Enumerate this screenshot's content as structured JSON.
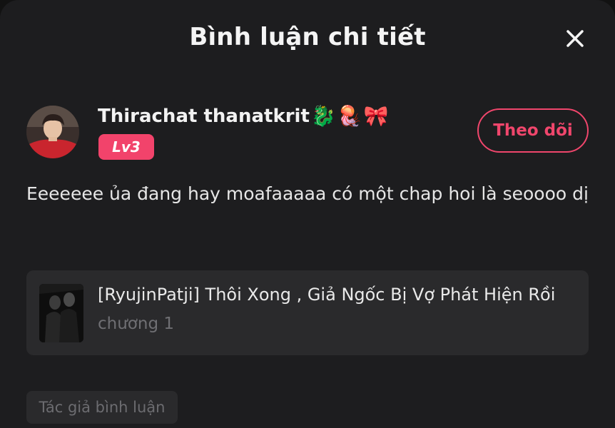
{
  "header": {
    "title": "Bình luận chi tiết",
    "close_icon": "close-icon"
  },
  "user": {
    "name": "Thirachat thanatkrit",
    "name_emojis": [
      "🐉",
      "🪼",
      "🎀"
    ],
    "level": "Lv3",
    "follow_label": "Theo dõi"
  },
  "comment": {
    "text": "Eeeeeee ủa đang hay moafaaaaa có một chap hoi là seoooo dị"
  },
  "chapter": {
    "title": "[RyujinPatji] Thôi Xong , Giả Ngốc Bị Vợ Phát Hiện Rồi",
    "subtitle": "chương 1"
  },
  "tag": {
    "label": "Tác giả bình luận"
  },
  "colors": {
    "accent": "#f0466c",
    "badge": "#f2436b",
    "background": "#1d1d1f",
    "card": "#2a2a2c"
  }
}
